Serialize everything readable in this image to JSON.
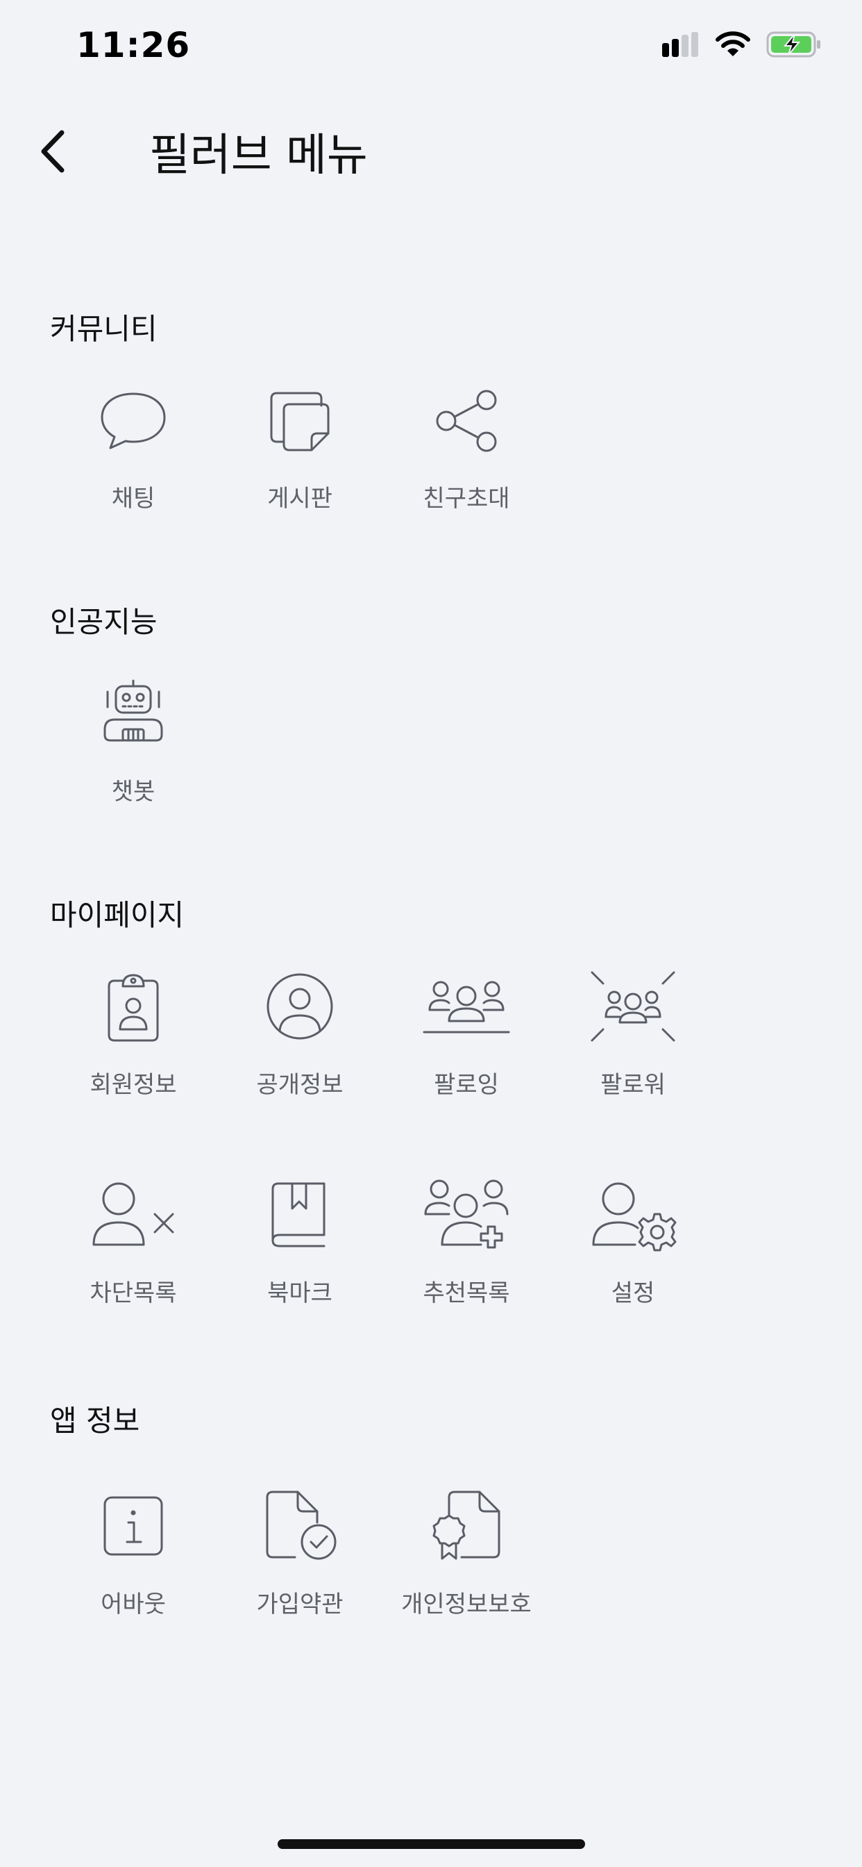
{
  "status_bar": {
    "time": "11:26",
    "battery_color": "#5ccf5a"
  },
  "nav": {
    "title": "필러브 메뉴"
  },
  "sections": {
    "community": {
      "title": "커뮤니티",
      "items": [
        {
          "label": "채팅",
          "icon": "chat-bubble-icon"
        },
        {
          "label": "게시판",
          "icon": "board-notes-icon"
        },
        {
          "label": "친구초대",
          "icon": "share-icon"
        }
      ]
    },
    "ai": {
      "title": "인공지능",
      "items": [
        {
          "label": "챗봇",
          "icon": "robot-icon"
        }
      ]
    },
    "mypage": {
      "title": "마이페이지",
      "items": [
        {
          "label": "회원정보",
          "icon": "id-badge-icon"
        },
        {
          "label": "공개정보",
          "icon": "user-circle-icon"
        },
        {
          "label": "팔로잉",
          "icon": "group-stage-icon"
        },
        {
          "label": "팔로워",
          "icon": "group-spotlight-icon"
        },
        {
          "label": "차단목록",
          "icon": "user-block-icon"
        },
        {
          "label": "북마크",
          "icon": "bookmark-book-icon"
        },
        {
          "label": "추천목록",
          "icon": "group-add-icon"
        },
        {
          "label": "설정",
          "icon": "user-settings-icon"
        }
      ]
    },
    "app_info": {
      "title": "앱 정보",
      "items": [
        {
          "label": "어바웃",
          "icon": "info-icon"
        },
        {
          "label": "가입약관",
          "icon": "document-check-icon"
        },
        {
          "label": "개인정보보호",
          "icon": "document-certificate-icon"
        }
      ]
    }
  }
}
